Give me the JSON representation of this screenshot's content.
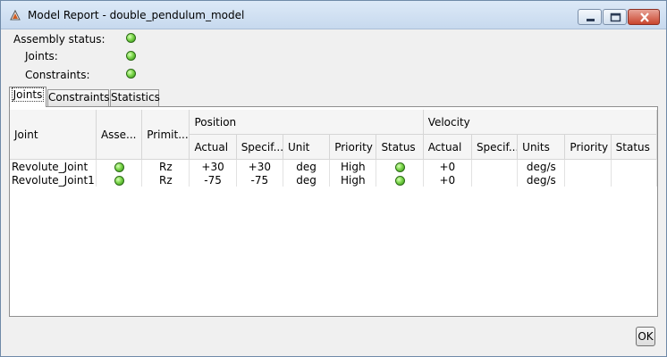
{
  "window": {
    "title": "Model Report - double_pendulum_model"
  },
  "status": {
    "assembly_label": "Assembly status:",
    "joints_label": "Joints:",
    "constraints_label": "Constraints:",
    "assembly_ok": true,
    "joints_ok": true,
    "constraints_ok": true
  },
  "tabs": [
    {
      "label": "Joints",
      "active": true
    },
    {
      "label": "Constraints",
      "active": false
    },
    {
      "label": "Statistics",
      "active": false
    }
  ],
  "table": {
    "group_headers": {
      "joint": "Joint",
      "assembled": "Asse...",
      "primitive": "Primit...",
      "position": "Position",
      "velocity": "Velocity"
    },
    "position_headers": [
      "Actual",
      "Specif...",
      "Unit",
      "Priority",
      "Status"
    ],
    "velocity_headers": [
      "Actual",
      "Specif...",
      "Units",
      "Priority",
      "Status"
    ],
    "rows": [
      {
        "joint": "Revolute_Joint",
        "assembled_ok": true,
        "primitive": "Rz",
        "pos_actual": "+30",
        "pos_specified": "+30",
        "pos_unit": "deg",
        "pos_priority": "High",
        "pos_status_ok": true,
        "vel_actual": "+0",
        "vel_specified": "",
        "vel_units": "deg/s",
        "vel_priority": "",
        "vel_status": ""
      },
      {
        "joint": "Revolute_Joint1",
        "assembled_ok": true,
        "primitive": "Rz",
        "pos_actual": "-75",
        "pos_specified": "-75",
        "pos_unit": "deg",
        "pos_priority": "High",
        "pos_status_ok": true,
        "vel_actual": "+0",
        "vel_specified": "",
        "vel_units": "deg/s",
        "vel_priority": "",
        "vel_status": ""
      }
    ]
  },
  "footer": {
    "ok_label": "OK"
  },
  "colors": {
    "status_ok": "#5cc131",
    "titlebar": "#c7d9ee",
    "close_button": "#c9452d"
  }
}
